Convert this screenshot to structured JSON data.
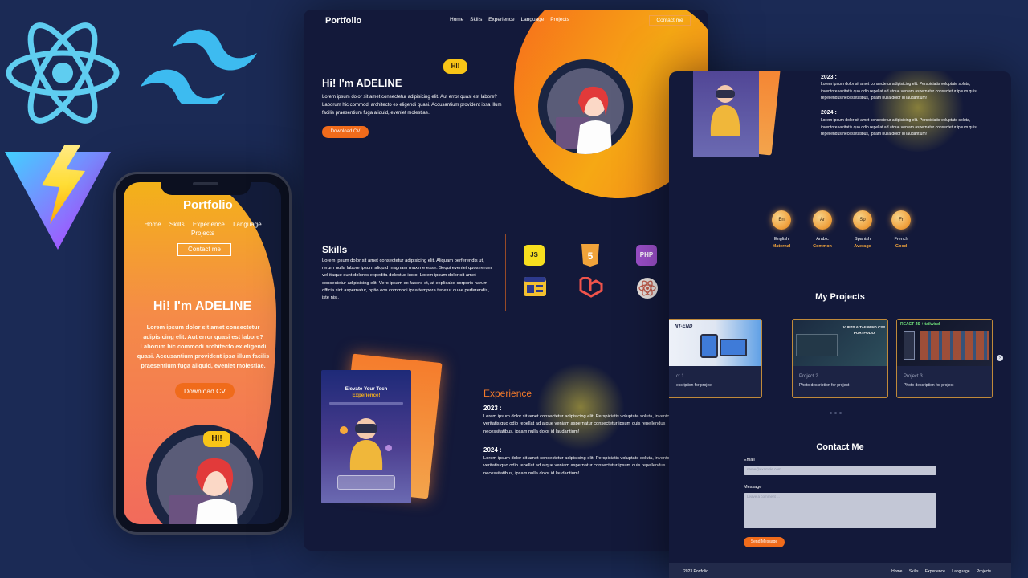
{
  "phone": {
    "brand": "Portfolio",
    "nav": [
      "Home",
      "Skills",
      "Experience",
      "Language",
      "Projects"
    ],
    "contact": "Contact me",
    "hi": "Hi! I'm ADELINE",
    "intro": "Lorem ipsum dolor sit amet consectetur adipisicing elit. Aut error quasi est labore? Laborum hic commodi architecto ex eligendi quasi. Accusantium provident ipsa illum facilis praesentium fuga aliquid, eveniet molestiae.",
    "download": "Download CV",
    "bubble": "HI!"
  },
  "desktop": {
    "brand": "Portfolio",
    "nav": [
      "Home",
      "Skills",
      "Experience",
      "Language",
      "Projects"
    ],
    "contact": "Contact me",
    "bubble": "HI!",
    "hi": "Hi! I'm ADELINE",
    "intro": "Lorem ipsum dolor sit amet consectetur adipisicing elit. Aut error quasi est labore? Laborum hic commodi architecto ex eligendi quasi. Accusantium provident ipsa illum facilis praesentium fuga aliquid, eveniet molestiae.",
    "download": "Download CV",
    "skills_title": "Skills",
    "skills_text": "Lorem ipsum dolor sit amet consectetur adipisicing elit. Aliquam perferendis ut, rerum nulla labore ipsum aliquid magnam maxime esse. Sequi eveniet quos rerum vel itaque sunt dolores expedita delectus iusto! Lorem ipsum dolor sit amet consectetur adipisicing elit. Vero ipsam ex facere et, at explicabo corporis harum officia sint aspernatur, optio eos commodi ipsa tempora tenetur quae perferendis, iste nisi.",
    "skills": [
      {
        "label": "JS",
        "icon": "javascript-icon",
        "color": "#f7df1e"
      },
      {
        "label": "5",
        "icon": "html5-icon",
        "color": "#f1a33a"
      },
      {
        "label": "PHP",
        "icon": "php-icon",
        "color": "#9b4fc9"
      },
      {
        "label": "",
        "icon": "browser-icon",
        "color": "#f3c02f"
      },
      {
        "label": "",
        "icon": "laravel-icon",
        "color": "#f0534b"
      },
      {
        "label": "",
        "icon": "react-icon",
        "color": "#e8e2df"
      }
    ],
    "exp_card_title": "Elevate Your Tech",
    "exp_card_title2": "Experience!",
    "exp_title": "Experience",
    "exp": [
      {
        "year": "2023 :",
        "text": "Lorem ipsum dolor sit amet consectetur adipisicing elit. Perspiciatis voluptate soluta, inventore veritatis quo odio repellat ad atque veniam aspernatur consectetur ipsum quis repellendus necessitatibus, ipsam nulla dolor id laudantium!"
      },
      {
        "year": "2024 :",
        "text": "Lorem ipsum dolor sit amet consectetur adipisicing elit. Perspiciatis voluptate soluta, inventore veritatis quo odio repellat ad atque veniam aspernatur consectetur ipsum quis repellendus necessitatibus, ipsam nulla dolor id laudantium!"
      }
    ]
  },
  "rpage": {
    "exp": [
      {
        "year": "2023 :",
        "text": "Lorem ipsum dolor sit amet consectetur adipisicing elit. Perspiciatis voluptate soluta, inventore veritatis quo odio repellat ad atque veniam aspernatur consectetur ipsum quis repellendus necessitatibus, ipsam nulla dolor id laudantium!"
      },
      {
        "year": "2024 :",
        "text": "Lorem ipsum dolor sit amet consectetur adipisicing elit. Perspiciatis voluptate soluta, inventore veritatis quo odio repellat ad atque veniam aspernatur consectetur ipsum quis repellendus necessitatibus, ipsam nulla dolor id laudantium!"
      }
    ],
    "languages": [
      {
        "code": "En",
        "name": "English",
        "level": "Maternal"
      },
      {
        "code": "Ar",
        "name": "Arabic",
        "level": "Common"
      },
      {
        "code": "Sp",
        "name": "Spanish",
        "level": "Average"
      },
      {
        "code": "Fr",
        "name": "French",
        "level": "Good"
      }
    ],
    "projects_title": "My Projects",
    "projects": [
      {
        "title": "ct 1",
        "desc": "escription for project",
        "banner": "NT-END"
      },
      {
        "title": "Project 2",
        "desc": "Photo description for project",
        "banner": "VUEJS & TAILWIND CSS PORTFOLIO"
      },
      {
        "title": "Project 3",
        "desc": "Photo description for project",
        "banner": "REACT JS + tailwind"
      }
    ],
    "contact_title": "Contact Me",
    "email_label": "Email",
    "email_placeholder": "name@example.com",
    "message_label": "Message",
    "message_placeholder": "Leave a comment ...",
    "send": "Send Message",
    "footer_copy": "2023 Portfolio.",
    "footer_links": [
      "Home",
      "Skills",
      "Experience",
      "Language",
      "Projects"
    ]
  }
}
